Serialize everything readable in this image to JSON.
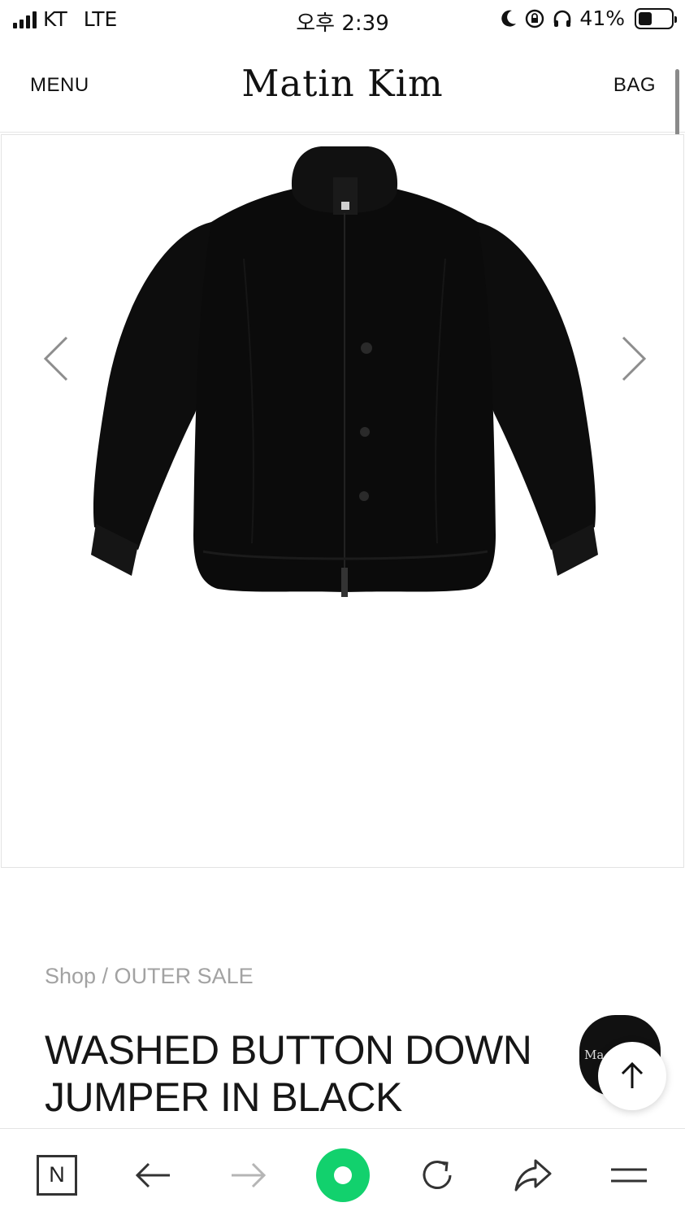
{
  "status_bar": {
    "carrier": "KT",
    "network": "LTE",
    "time": "오후 2:39",
    "battery_percent": "41%",
    "battery_level": 0.41,
    "icons": [
      "signal-icon",
      "moon-icon",
      "rotation-lock-icon",
      "headphones-icon",
      "battery-icon"
    ]
  },
  "header": {
    "menu_label": "MENU",
    "brand": "Matin Kim",
    "bag_label": "BAG"
  },
  "gallery": {
    "image_alt": "Black washed button down puffer jumper",
    "prev_icon": "chevron-left-icon",
    "next_icon": "chevron-right-icon"
  },
  "product": {
    "breadcrumb": "Shop / OUTER SALE",
    "title_line1": "WASHED BUTTON DOWN",
    "title_line2": "JUMPER IN BLACK",
    "badge_text": "Ma"
  },
  "toolbar": {
    "home_label": "N",
    "icons": [
      "naver-home-icon",
      "back-arrow-icon",
      "forward-arrow-icon",
      "green-dot-icon",
      "refresh-icon",
      "share-icon",
      "menu-icon"
    ]
  },
  "colors": {
    "accent_green": "#12d16d",
    "text": "#111111",
    "muted": "#a2a2a2"
  }
}
